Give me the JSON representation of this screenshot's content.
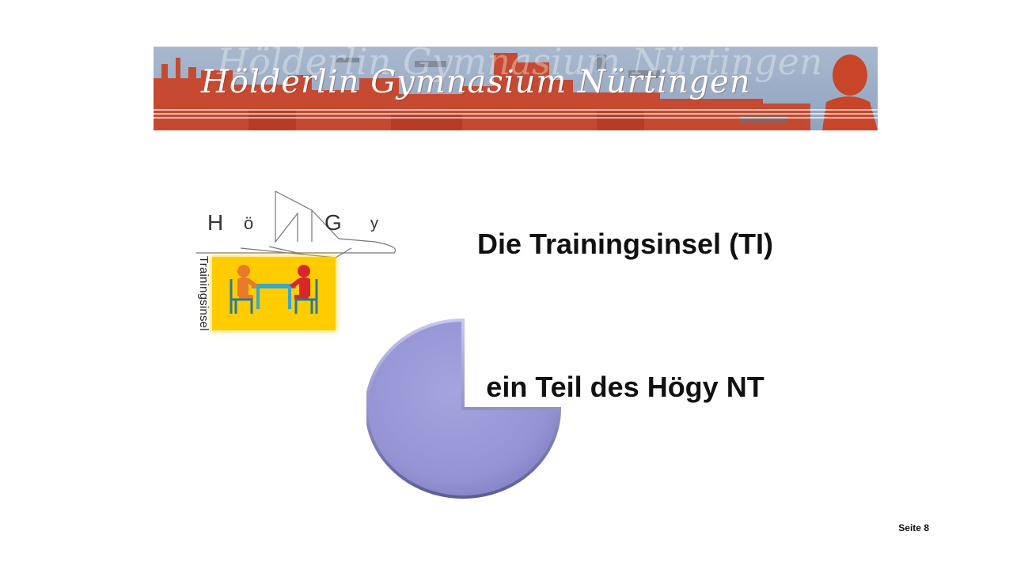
{
  "banner": {
    "script_text": "Hölderlin Gymnasium Nürtingen",
    "colors": {
      "sky": "#9fb1c9",
      "buildings": "#c8452a"
    }
  },
  "logo": {
    "letters": [
      "H",
      "ö",
      "G",
      "y"
    ],
    "vertical_label": "Trainingsinsel",
    "box_color": "#ffcc00"
  },
  "content": {
    "title": "Die Trainingsinsel (TI)",
    "subtitle": "ein Teil des Högy NT"
  },
  "pie": {
    "fill": "#9898d6",
    "share": 0.75
  },
  "footer": {
    "page_label": "Seite 8"
  }
}
